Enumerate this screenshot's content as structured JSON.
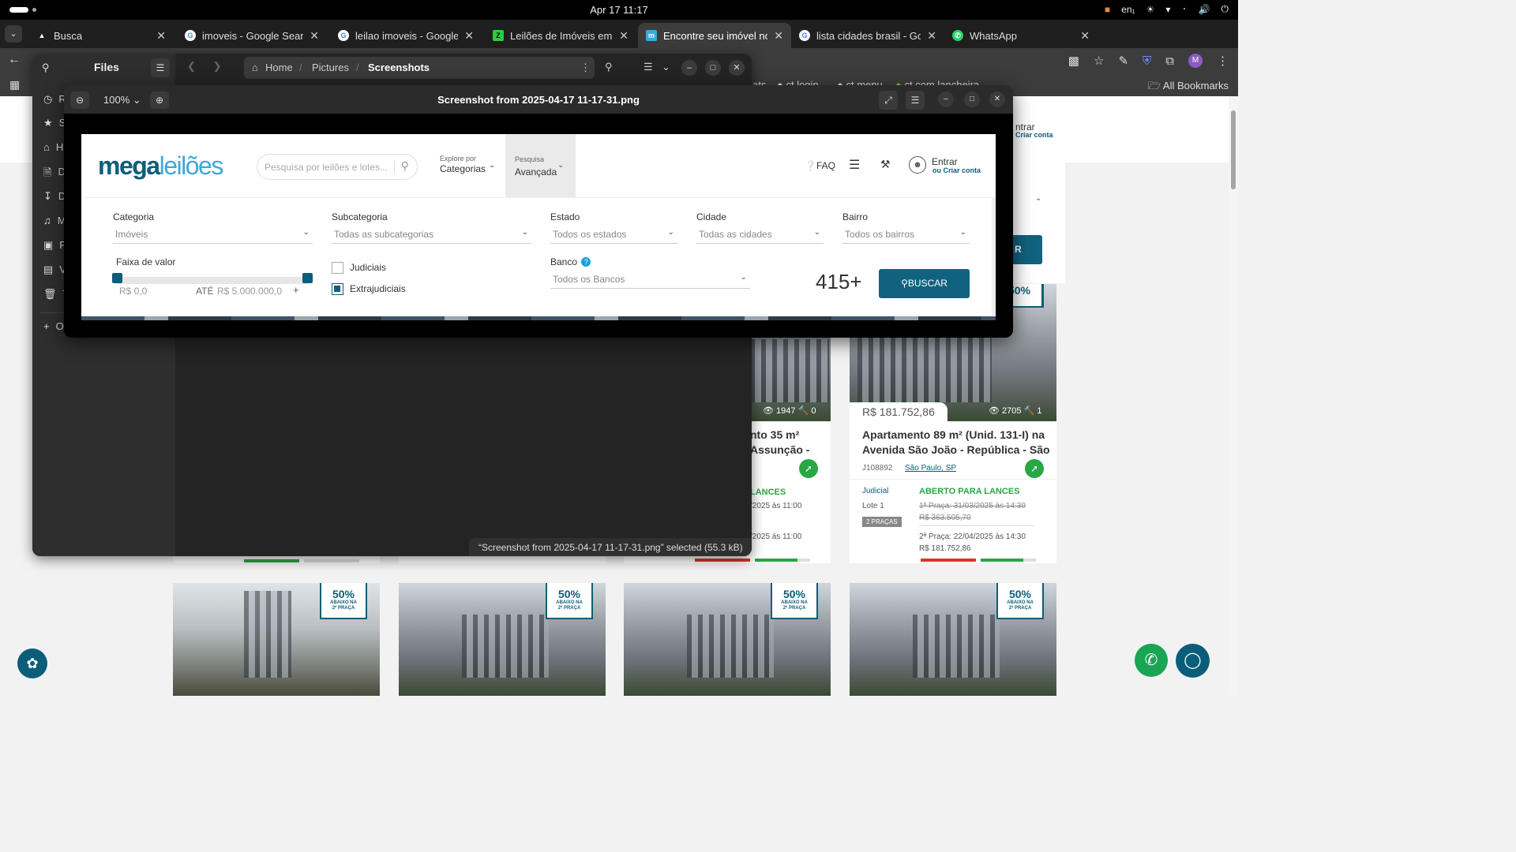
{
  "topbar": {
    "clock": "Apr 17  11:17",
    "lang": "en₁"
  },
  "tabs": [
    {
      "title": "Busca",
      "fav": "▲",
      "favColor": "#ffffff"
    },
    {
      "title": "imoveis - Google Search",
      "fav": "G",
      "favColor": "#ffffff"
    },
    {
      "title": "leilao imoveis - Google Se",
      "fav": "G",
      "favColor": "#ffffff"
    },
    {
      "title": "Leilões de Imóveis em RJ",
      "fav": "Z",
      "favColor": "#2ecc40"
    },
    {
      "title": "Encontre seu imóvel nos",
      "fav": "m",
      "favColor": "#3ea8d8"
    },
    {
      "title": "lista cidades brasil - Goog",
      "fav": "G",
      "favColor": "#ffffff"
    },
    {
      "title": "WhatsApp",
      "fav": "✆",
      "favColor": "#25d366"
    }
  ],
  "bookmarks": {
    "items": [
      "ats",
      "ct login",
      "ct menu",
      "ct com lancheira"
    ],
    "all": "All Bookmarks"
  },
  "profile_initial": "M",
  "files": {
    "title": "Files",
    "path": [
      "Home",
      "Pictures",
      "Screenshots"
    ],
    "sidebar_initials": [
      "R",
      "S",
      "H",
      "D",
      "D",
      "M",
      "P",
      "V",
      "T",
      "O"
    ],
    "status": "“Screenshot from 2025-04-17 11-17-31.png” selected  (55.3 kB)"
  },
  "viewer": {
    "zoom": "100%",
    "title": "Screenshot from 2025-04-17 11-17-31.png"
  },
  "shot": {
    "logo_a": "mega",
    "logo_b": "leilões",
    "search_placeholder": "Pesquisa por leilões e lotes...",
    "explore_k": "Explore por",
    "explore_v": "Categorias",
    "adv_k": "Pesquisa",
    "adv_v": "Avançada",
    "faq": "FAQ",
    "entrar": "Entrar",
    "criar": "ou Criar conta",
    "filters": {
      "categoria": {
        "label": "Categoria",
        "value": "Imóveis"
      },
      "subcategoria": {
        "label": "Subcategoria",
        "value": "Todas as subcategorias"
      },
      "estado": {
        "label": "Estado",
        "value": "Todos os estados"
      },
      "cidade": {
        "label": "Cidade",
        "value": "Todas as cidades"
      },
      "bairro": {
        "label": "Bairro",
        "value": "Todos os bairros"
      },
      "faixa": {
        "label": "Faixa de valor",
        "min": "R$ 0,0",
        "ate": "ATÉ",
        "max": "R$ 5.000.000,0",
        "plus": "+"
      },
      "judiciais": {
        "label": "Judiciais",
        "checked": false
      },
      "extrajudiciais": {
        "label": "Extrajudiciais",
        "checked": true
      },
      "banco": {
        "label": "Banco",
        "value": "Todos os Bancos"
      }
    },
    "count": "415+",
    "buscar": "BUSCAR"
  },
  "page": {
    "entrar": "ntrar",
    "criar": "Criar conta",
    "buscar": "R",
    "card3": {
      "views": "1947",
      "bids": "0",
      "title_a": "nto 35 m²",
      "title_b": "Assunção -",
      "status": "LANCES",
      "d1": "/2025 às 11:00",
      "d2": "/2025 às 11:00"
    },
    "card4": {
      "price": "R$ 181.752,86",
      "views": "2705",
      "bids": "1",
      "title_a": "Apartamento 89 m² (Unid. 131-I) na",
      "title_b": "Avenida São João - República - São",
      "id": "J108892",
      "loc": "São Paulo, SP",
      "type": "Judicial",
      "lote": "Lote 1",
      "pracas": "2 PRAÇAS",
      "status": "ABERTO PARA LANCES",
      "p1": "1ª Praça: 31/03/2025 às 14:30",
      "p1v": "R$ 363.505,70",
      "p2": "2ª Praça: 22/04/2025 às 14:30",
      "p2v": "R$ 181.752,86"
    },
    "badge_pct": "50%",
    "badge_sub1": "ABAIXO NA",
    "badge_sub2": "2ª PRAÇA"
  }
}
